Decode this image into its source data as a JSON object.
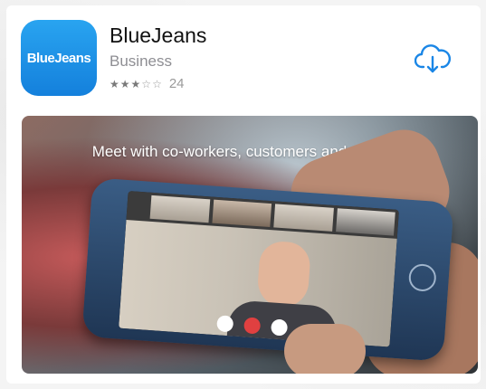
{
  "app": {
    "icon_text": "BlueJeans",
    "name": "BlueJeans",
    "category": "Business",
    "rating": {
      "stars": 3.5,
      "max": 5,
      "count": "24"
    },
    "download_icon": "cloud-download-icon"
  },
  "screenshot": {
    "caption": "Meet with co-workers, customers and partners"
  },
  "colors": {
    "accent": "#1a86e6",
    "icon_gradient_top": "#29a4f0",
    "icon_gradient_bottom": "#1480dc",
    "secondary_text": "#8e8e93"
  }
}
